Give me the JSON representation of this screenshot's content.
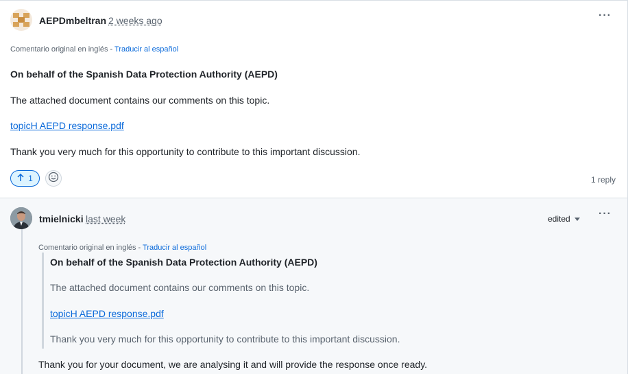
{
  "comment": {
    "author": "AEPDmbeltran",
    "time": "2 weeks ago",
    "more": "···",
    "translate_prefix": "Comentario original en inglés - ",
    "translate_link": "Traducir al español",
    "heading": "On behalf of the Spanish Data Protection Authority (AEPD)",
    "body1": "The attached document contains our comments on this topic.",
    "attachment": "topicH AEPD response.pdf",
    "body2": "Thank you very much for this opportunity to contribute to this important discussion.",
    "upvote_count": "1",
    "reply_count": "1 reply"
  },
  "reply": {
    "author": "tmielnicki",
    "time": "last week",
    "edited": "edited",
    "more": "···",
    "translate_prefix": "Comentario original en inglés - ",
    "translate_link": "Traducir al español",
    "quote_heading": "On behalf of the Spanish Data Protection Authority (AEPD)",
    "quote_body1": "The attached document contains our comments on this topic.",
    "quote_attachment": "topicH AEPD response.pdf",
    "quote_body2": "Thank you very much for this opportunity to contribute to this important discussion.",
    "body": "Thank you for your document, we are analysing it and will provide the response once ready."
  },
  "colors": {
    "accent": "#0969da",
    "muted": "#59636e",
    "reply_bg": "#f6f8fa"
  }
}
